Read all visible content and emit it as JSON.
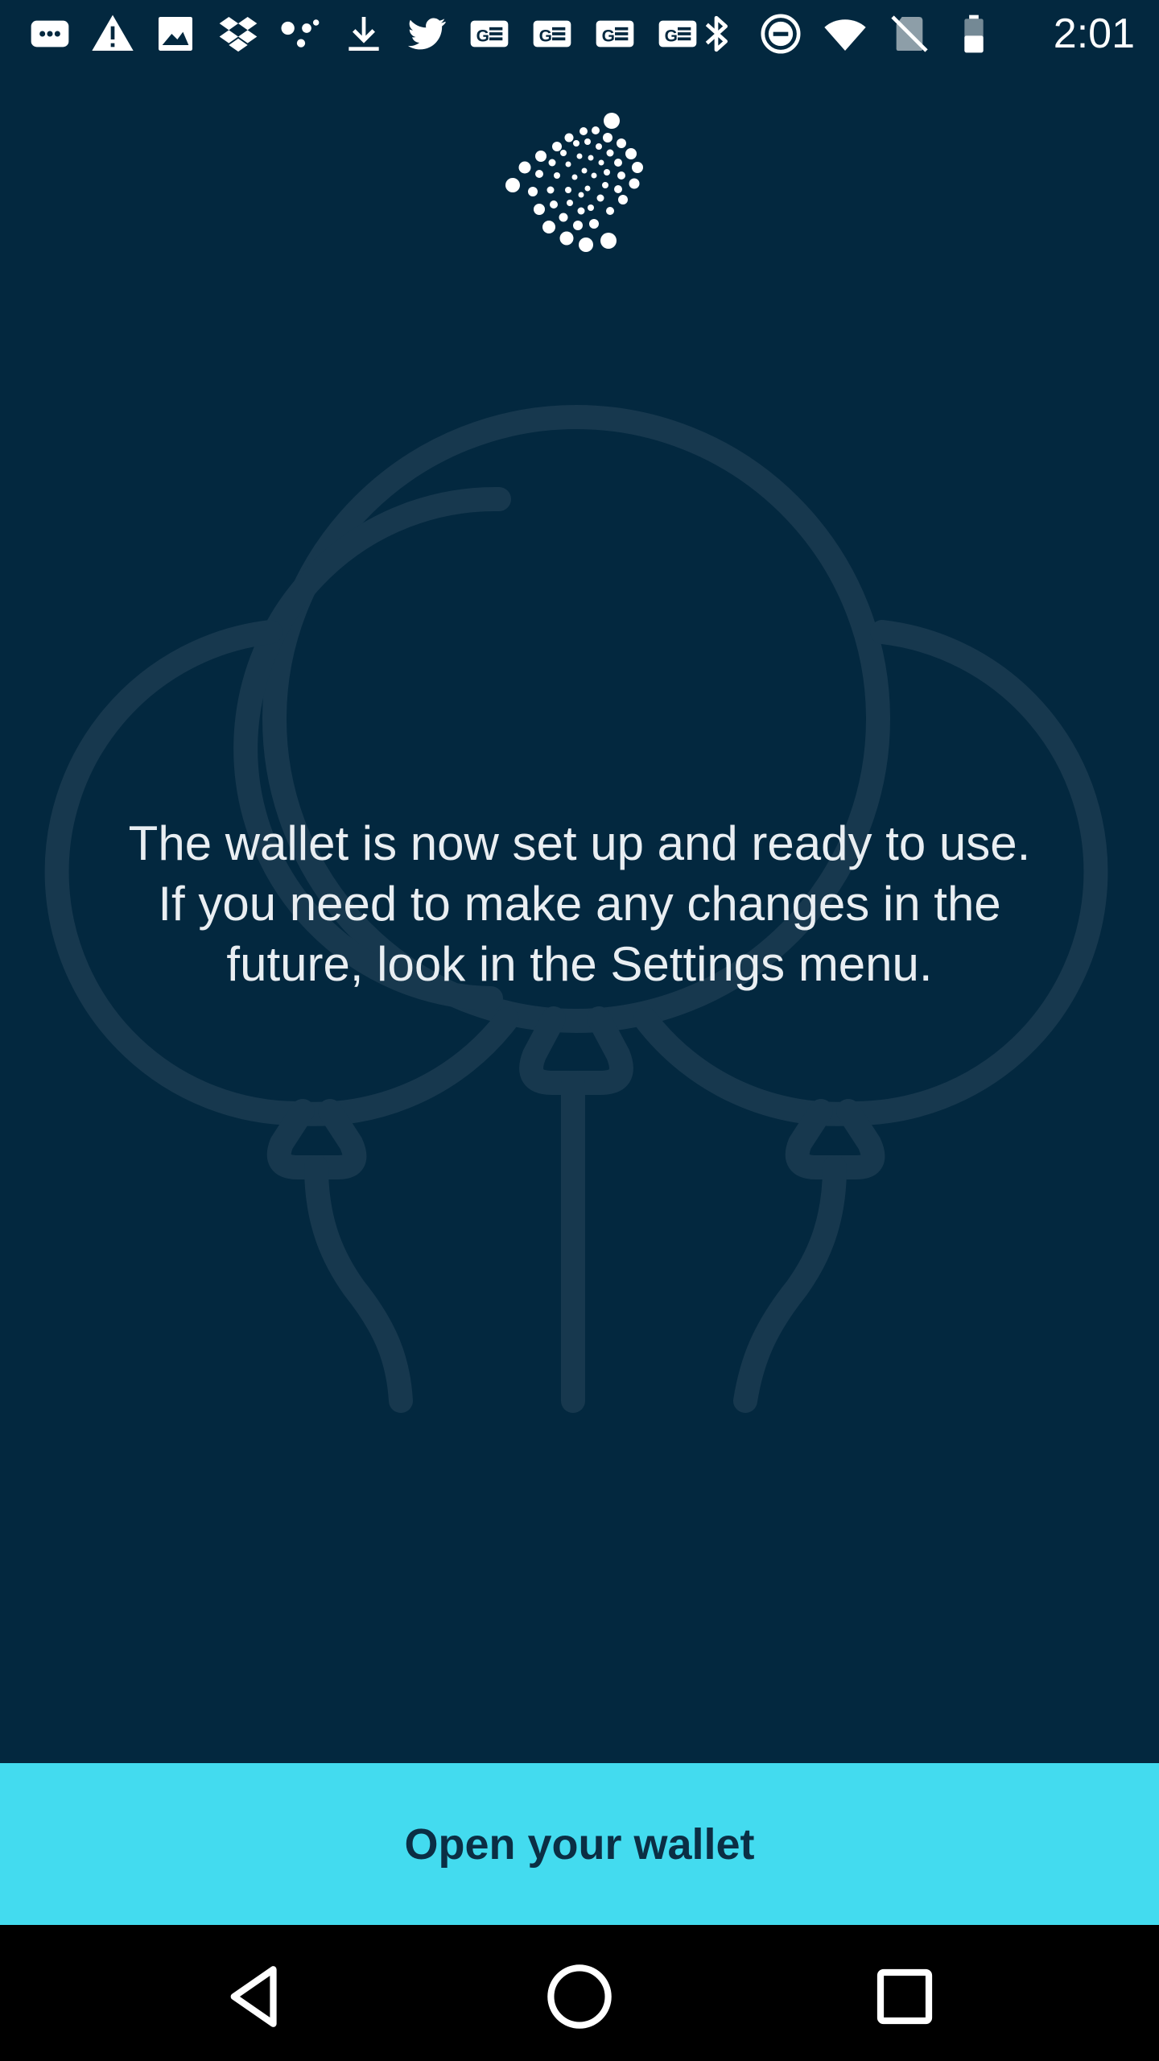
{
  "status_bar": {
    "time": "2:01",
    "icons_left": [
      "message-icon",
      "warning-icon",
      "image-icon",
      "dropbox-icon",
      "dots-icon",
      "download-icon",
      "twitter-icon",
      "ge-icon",
      "ge-icon",
      "ge-icon",
      "ge-icon"
    ],
    "icons_right": [
      "bluetooth-icon",
      "do-not-disturb-icon",
      "wifi-icon",
      "no-sim-icon",
      "battery-icon"
    ]
  },
  "main": {
    "message": "The wallet is now set up and ready to use. If you need to make any changes in the future, look in the Settings menu.",
    "button_label": "Open your wallet"
  },
  "colors": {
    "background": "#03283f",
    "accent_button": "#43dbef",
    "button_text": "#0b2e44",
    "balloon_outline": "#17384e"
  },
  "nav_bar": {
    "buttons": [
      "back-icon",
      "home-icon",
      "recents-icon"
    ]
  }
}
